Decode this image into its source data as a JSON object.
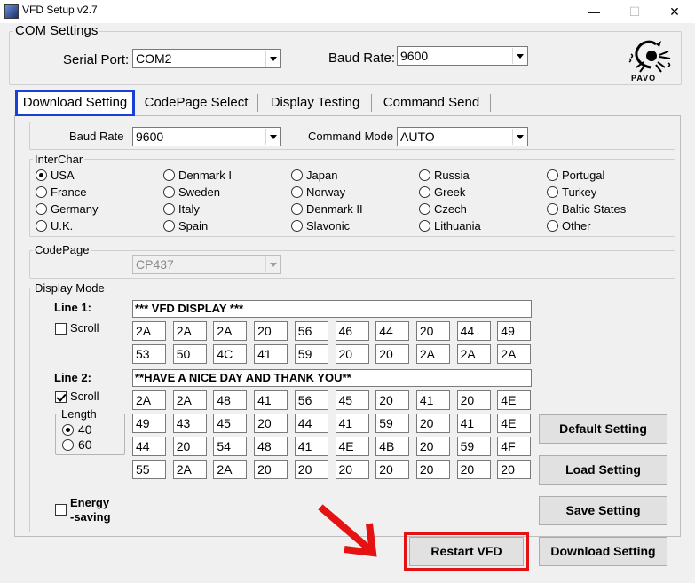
{
  "window": {
    "title": "VFD Setup v2.7",
    "minimize_glyph": "—",
    "maximize_glyph": "☐",
    "close_glyph": "✕"
  },
  "com_settings": {
    "title": "COM Settings",
    "serial_port_label": "Serial Port:",
    "serial_port_value": "COM2",
    "baud_rate_label": "Baud Rate:",
    "baud_rate_value": "9600",
    "logo_text": "PAVO"
  },
  "tabs": [
    {
      "label": "Download Setting",
      "active": true
    },
    {
      "label": "CodePage Select"
    },
    {
      "label": "Display Testing"
    },
    {
      "label": "Command Send"
    }
  ],
  "download_setting": {
    "baud_rate_label": "Baud Rate",
    "baud_rate_value": "9600",
    "command_mode_label": "Command Mode",
    "command_mode_value": "AUTO"
  },
  "interchar": {
    "title": "InterChar",
    "options": [
      [
        "USA",
        "France",
        "Germany",
        "U.K."
      ],
      [
        "Denmark I",
        "Sweden",
        "Italy",
        "Spain"
      ],
      [
        "Japan",
        "Norway",
        "Denmark II",
        "Slavonic"
      ],
      [
        "Russia",
        "Greek",
        "Czech",
        "Lithuania"
      ],
      [
        "Portugal",
        "Turkey",
        "Baltic States",
        "Other"
      ]
    ],
    "selected": "USA"
  },
  "codepage": {
    "title": "CodePage",
    "value": "CP437"
  },
  "display_mode": {
    "title": "Display Mode",
    "line1_label": "Line 1:",
    "line1_text": "*** VFD DISPLAY  ***",
    "line1_scroll_label": "Scroll",
    "line1_scroll_checked": false,
    "line1_hex": [
      [
        "2A",
        "2A",
        "2A",
        "20",
        "56",
        "46",
        "44",
        "20",
        "44",
        "49"
      ],
      [
        "53",
        "50",
        "4C",
        "41",
        "59",
        "20",
        "20",
        "2A",
        "2A",
        "2A"
      ]
    ],
    "line2_label": "Line 2:",
    "line2_text": "**HAVE A NICE DAY AND THANK YOU**",
    "line2_scroll_label": "Scroll",
    "line2_scroll_checked": true,
    "line2_hex": [
      [
        "2A",
        "2A",
        "48",
        "41",
        "56",
        "45",
        "20",
        "41",
        "20",
        "4E"
      ],
      [
        "49",
        "43",
        "45",
        "20",
        "44",
        "41",
        "59",
        "20",
        "41",
        "4E"
      ],
      [
        "44",
        "20",
        "54",
        "48",
        "41",
        "4E",
        "4B",
        "20",
        "59",
        "4F"
      ],
      [
        "55",
        "2A",
        "2A",
        "20",
        "20",
        "20",
        "20",
        "20",
        "20",
        "20"
      ]
    ],
    "length_title": "Length",
    "length_options": [
      "40",
      "60"
    ],
    "length_selected": "40",
    "energy_label_1": "Energy",
    "energy_label_2": "-saving",
    "energy_checked": false
  },
  "buttons": {
    "default_setting": "Default Setting",
    "load_setting": "Load Setting",
    "save_setting": "Save Setting",
    "restart_vfd": "Restart VFD",
    "download_setting": "Download Setting"
  },
  "annotation_colors": {
    "tab_highlight": "#1a3fd6",
    "restart_highlight": "#e41212",
    "arrow": "#e41212"
  }
}
